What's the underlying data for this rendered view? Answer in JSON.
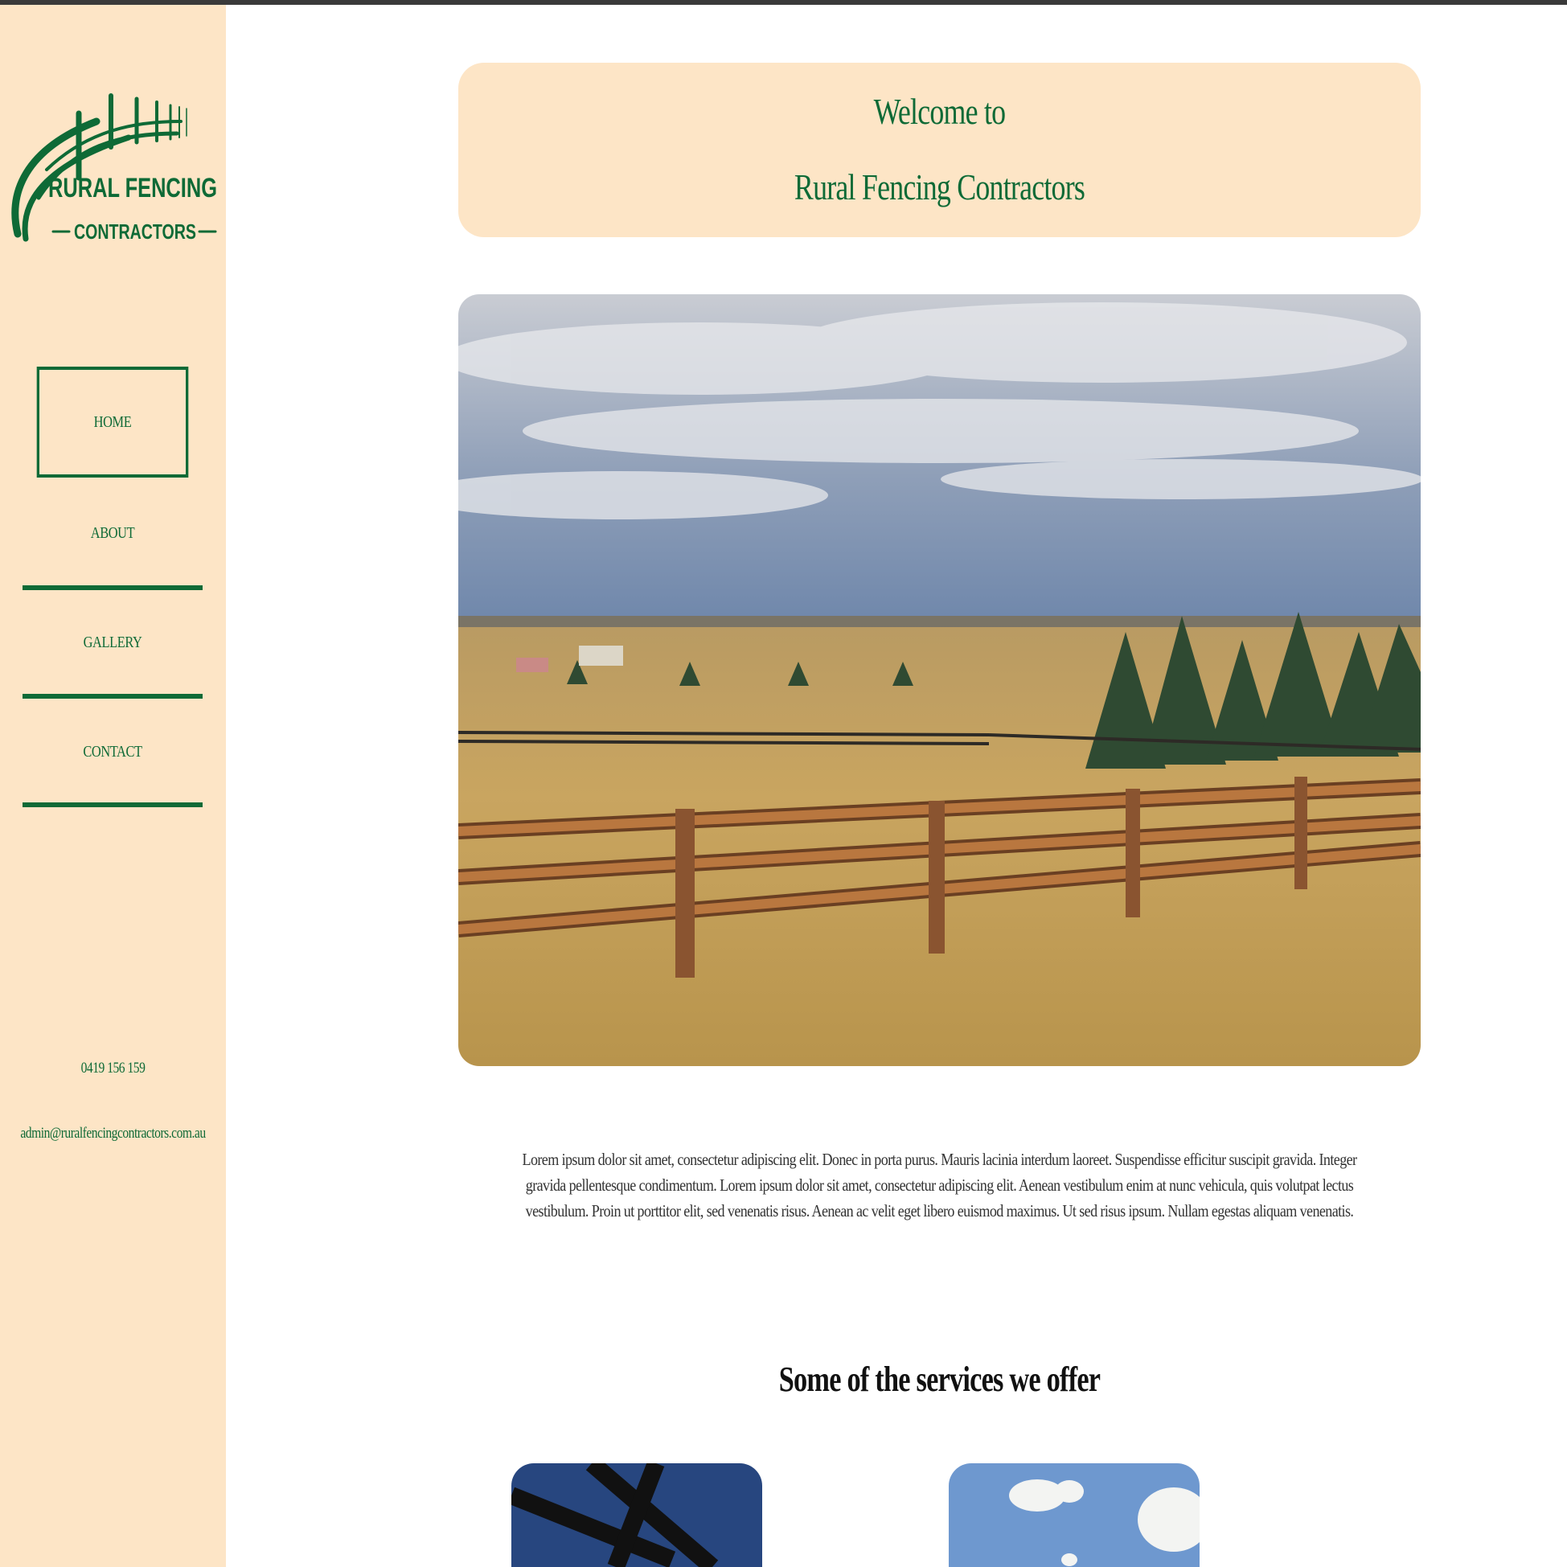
{
  "brand": {
    "logo_line1": "RURAL FENCING",
    "logo_line2": "CONTRACTORS",
    "primary_color": "#0e6a36",
    "sidebar_color": "#fde5c6"
  },
  "nav": {
    "items": [
      {
        "label": "HOME",
        "active": true
      },
      {
        "label": "ABOUT",
        "active": false
      },
      {
        "label": "GALLERY",
        "active": false
      },
      {
        "label": "CONTACT",
        "active": false
      }
    ]
  },
  "contact": {
    "phone": "0419 156 159",
    "email": "admin@ruralfencingcontractors.com.au"
  },
  "welcome": {
    "line1": "Welcome to",
    "line2": "Rural Fencing Contractors"
  },
  "intro_text": "Lorem ipsum dolor sit amet, consectetur adipiscing elit. Donec in porta purus. Mauris lacinia interdum laoreet. Suspendisse efficitur suscipit gravida. Integer gravida pellentesque condimentum. Lorem ipsum dolor sit amet, consectetur adipiscing elit. Aenean vestibulum enim at nunc vehicula, quis volutpat lectus vestibulum. Proin ut porttitor elit, sed venenatis risus. Aenean ac velit eget libero euismod maximus. Ut sed risus ipsum. Nullam egestas aliquam venenatis.",
  "services": {
    "title": "Some of the services we offer"
  }
}
